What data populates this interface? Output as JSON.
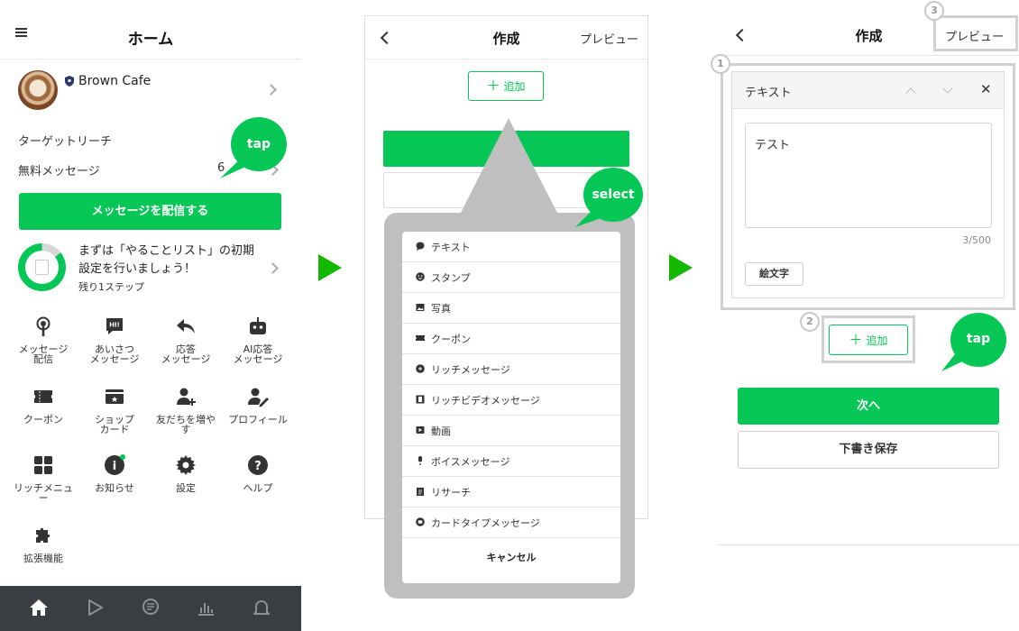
{
  "colors": {
    "brand": "#06c755",
    "arrow": "#15b800",
    "callout": "#bfbfbf",
    "highlight": "#d0d0d0",
    "tabbar": "#3a3d41"
  },
  "home": {
    "title": "ホーム",
    "account_name": "Brown Cafe",
    "target_reach_label": "ターゲットリーチ",
    "free_messages_label": "無料メッセージ",
    "free_messages_value": "6",
    "send_button": "メッセージを配信する",
    "todo": {
      "text": "まずは「やることリスト」の初期設定を行いましょう！",
      "sub": "残り1ステップ",
      "progress_fraction": 0.86
    },
    "grid": [
      {
        "icon": "broadcast-icon",
        "label_lines": [
          "メッセージ",
          "配信"
        ]
      },
      {
        "icon": "greeting-bubble-icon",
        "badge": "HI!",
        "label_lines": [
          "あいさつ",
          "メッセージ"
        ]
      },
      {
        "icon": "reply-arrow-icon",
        "label_lines": [
          "応答",
          "メッセージ"
        ]
      },
      {
        "icon": "robot-icon",
        "label_lines": [
          "AI応答",
          "メッセージ"
        ]
      },
      {
        "icon": "coupon-icon",
        "label_lines": [
          "クーポン"
        ]
      },
      {
        "icon": "shop-card-icon",
        "label_lines": [
          "ショップ",
          "カード"
        ]
      },
      {
        "icon": "add-friend-icon",
        "label_lines": [
          "友だちを増や",
          "す"
        ]
      },
      {
        "icon": "profile-edit-icon",
        "label_lines": [
          "プロフィール"
        ]
      },
      {
        "icon": "rich-menu-icon",
        "label_lines": [
          "リッチメニュ",
          "ー"
        ]
      },
      {
        "icon": "info-icon",
        "badge": "i",
        "label_lines": [
          "お知らせ"
        ]
      },
      {
        "icon": "settings-gear-icon",
        "label_lines": [
          "設定"
        ]
      },
      {
        "icon": "help-icon",
        "badge": "?",
        "label_lines": [
          "ヘルプ"
        ]
      },
      {
        "icon": "extension-puzzle-icon",
        "label_lines": [
          "拡張機能"
        ]
      }
    ],
    "tabs": [
      "home-icon",
      "play-icon",
      "chat-icon",
      "analytics-icon",
      "notification-bell-icon"
    ]
  },
  "composer": {
    "title": "作成",
    "preview": "プレビュー",
    "add_button": "追加",
    "add_plus": "＋",
    "menu": [
      {
        "icon": "speech-bubble-icon",
        "label": "テキスト"
      },
      {
        "icon": "smiley-icon",
        "label": "スタンプ"
      },
      {
        "icon": "photo-icon",
        "label": "写真"
      },
      {
        "icon": "coupon-icon",
        "label": "クーポン"
      },
      {
        "icon": "rich-message-icon",
        "label": "リッチメッセージ"
      },
      {
        "icon": "film-icon",
        "label": "リッチビデオメッセージ"
      },
      {
        "icon": "video-play-icon",
        "label": "動画"
      },
      {
        "icon": "microphone-icon",
        "label": "ボイスメッセージ"
      },
      {
        "icon": "clipboard-icon",
        "label": "リサーチ"
      },
      {
        "icon": "card-icon",
        "label": "カードタイプメッセージ"
      }
    ],
    "cancel": "キャンセル"
  },
  "editor": {
    "title": "作成",
    "preview": "プレビュー",
    "card_title": "テキスト",
    "text_value": "テスト",
    "counter": "3/500",
    "emoji_button": "絵文字",
    "add_button": "追加",
    "add_plus": "＋",
    "next_button": "次へ",
    "draft_button": "下書き保存",
    "markers": [
      "1",
      "2",
      "3"
    ]
  },
  "annotations": {
    "tap": "tap",
    "select": "select"
  }
}
